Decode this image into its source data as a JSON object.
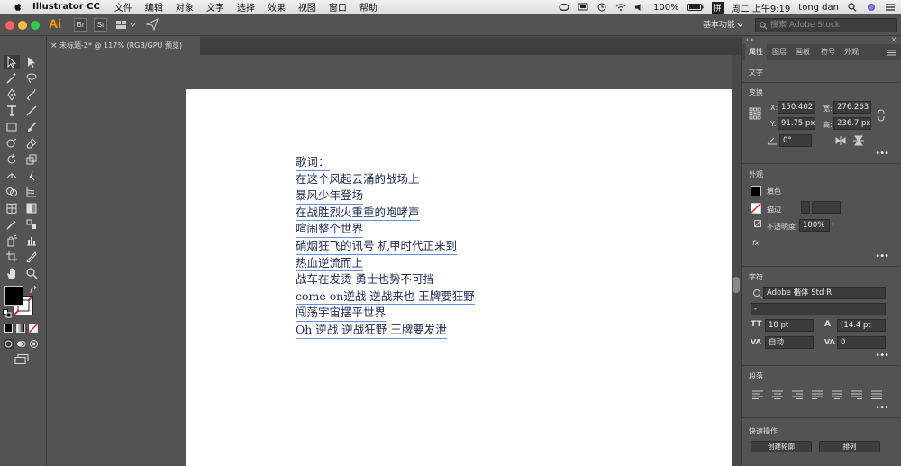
{
  "menubar": {
    "app_name": "Illustrator CC",
    "items": [
      "文件",
      "编辑",
      "对象",
      "文字",
      "选择",
      "效果",
      "视图",
      "窗口",
      "帮助"
    ],
    "battery": "100%",
    "input_method": "拼",
    "clock": "周二 上午9:19",
    "user": "tong dan"
  },
  "appbar": {
    "logo": "Ai",
    "br": "Br",
    "st": "St",
    "workspace": "基本功能",
    "search_placeholder": "搜索 Adobe Stock"
  },
  "document": {
    "tab_title": "未标题-2* @ 117% (RGB/GPU 预览)",
    "lyrics": [
      "歌词：",
      "在这个风起云涌的战场上",
      "暴风少年登场",
      "在战胜烈火重重的咆哮声",
      "喧闹整个世界",
      "硝烟狂飞的讯号 机甲时代正来到",
      "热血逆流而上",
      "战车在发烫 勇士也势不可挡",
      "come on逆战 逆战来也 王牌要狂野",
      "闯荡宇宙摆平世界",
      "Oh 逆战 逆战狂野 王牌要发泄"
    ]
  },
  "panel": {
    "tabs": [
      "属性",
      "图层",
      "画板",
      "符号",
      "外观"
    ],
    "active_tab": "属性",
    "type_label": "文字",
    "transform": {
      "heading": "变换",
      "x_label": "X:",
      "x": "150.402",
      "w_label": "宽:",
      "w": "276.263",
      "y_label": "Y:",
      "y": "91.75 px",
      "h_label": "高:",
      "h": "236.7 px",
      "angle": "0°"
    },
    "appearance": {
      "heading": "外观",
      "fill": "填色",
      "stroke": "描边",
      "opacity_label": "不透明度",
      "opacity": "100%",
      "fx": "fx."
    },
    "character": {
      "heading": "字符",
      "font": "Adobe 楷体 Std R",
      "style": "-",
      "size": "18 pt",
      "leading": "(14.4 pt",
      "tracking": "自动",
      "kerning": "0"
    },
    "paragraph": {
      "heading": "段落"
    },
    "quick_actions": {
      "heading": "快速操作",
      "create_outlines": "创建轮廓",
      "arrange": "排列"
    }
  },
  "colors": {
    "fill": "#000000",
    "accent": "#ff9a00",
    "text": "#1c2a55"
  }
}
